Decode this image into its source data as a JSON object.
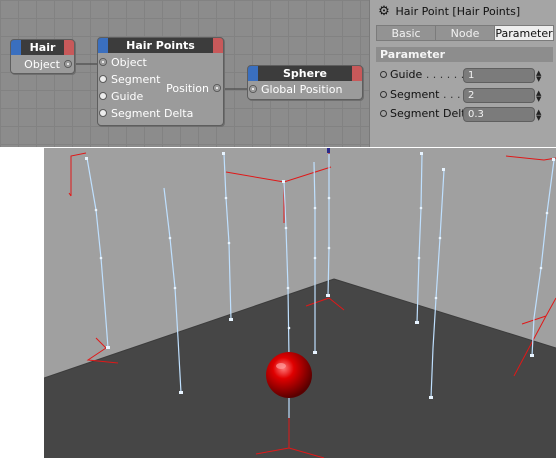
{
  "node_editor": {
    "nodes": {
      "hair": {
        "title": "Hair",
        "ports": {
          "object": "Object"
        }
      },
      "hair_points": {
        "title": "Hair Points",
        "inputs": {
          "object": "Object",
          "segment": "Segment",
          "guide": "Guide",
          "segment_delta": "Segment Delta"
        },
        "outputs": {
          "position": "Position"
        }
      },
      "sphere": {
        "title": "Sphere",
        "ports": {
          "global_position": "Global Position"
        }
      }
    },
    "colors": {
      "input_pin": "#3a6fbf",
      "output_pin": "#c8595a",
      "header": "#3c3c3c"
    }
  },
  "attributes": {
    "title": "Hair Point [Hair Points]",
    "tabs": {
      "basic": "Basic",
      "node": "Node",
      "parameter": "Parameter"
    },
    "active_tab": "Parameter",
    "section": "Parameter",
    "fields": {
      "guide": {
        "label": "Guide",
        "dots": ". . . . . . .",
        "value": "1"
      },
      "segment": {
        "label": "Segment",
        "dots": ". . .",
        "value": "2"
      },
      "segment_delta": {
        "label": "Segment Delta",
        "value": "0.3"
      }
    }
  },
  "viewport": {
    "icons": {
      "sphere": "red-sphere",
      "hairs": "light-blue-guides",
      "axes": "red-axis-handles"
    },
    "colors": {
      "floor": "#464646",
      "background": "#a0a0a0",
      "hair": "#bfe0ff",
      "axis": "#e01818",
      "sphere": "#d10000"
    }
  }
}
